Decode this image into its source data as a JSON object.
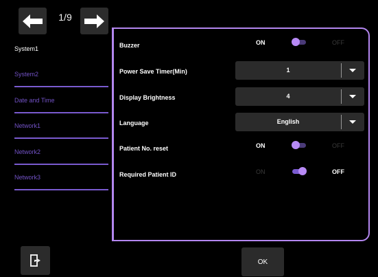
{
  "header": {
    "page_indicator": "1/9",
    "prev_icon": "arrow-left-icon",
    "next_icon": "arrow-right-icon"
  },
  "sidebar": {
    "items": [
      {
        "label": "System1",
        "active": true
      },
      {
        "label": "System2",
        "active": false
      },
      {
        "label": "Date and Time",
        "active": false
      },
      {
        "label": "Network1",
        "active": false
      },
      {
        "label": "Network2",
        "active": false
      },
      {
        "label": "Network3",
        "active": false
      }
    ]
  },
  "settings": {
    "buzzer": {
      "label": "Buzzer",
      "on": "ON",
      "off": "OFF",
      "state": "ON"
    },
    "power_save": {
      "label": "Power Save Timer(Min)",
      "value": "1"
    },
    "brightness": {
      "label": "Display Brightness",
      "value": "4"
    },
    "language": {
      "label": "Language",
      "value": "English"
    },
    "patient_reset": {
      "label": "Patient No. reset",
      "on": "ON",
      "off": "OFF",
      "state": "ON"
    },
    "required_id": {
      "label": "Required Patient ID",
      "on": "ON",
      "off": "OFF",
      "state": "OFF"
    }
  },
  "footer": {
    "exit_icon": "exit-door-icon",
    "ok_label": "OK"
  },
  "colors": {
    "accent": "#b487f0",
    "sidebar_inactive": "#7252c6",
    "control_bg": "#2b2b2b"
  }
}
